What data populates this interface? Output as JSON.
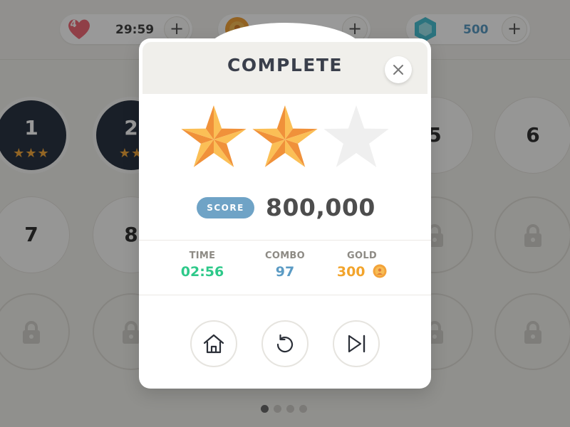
{
  "topbar": {
    "lives": {
      "count": "4",
      "timer": "29:59",
      "plus": "+"
    },
    "coins": {
      "plus": "+"
    },
    "gems": {
      "amount": "500",
      "plus": "+"
    }
  },
  "levels": {
    "l1": {
      "number": "1",
      "stars": "★★★"
    },
    "l2": {
      "number": "2",
      "stars": "★★"
    },
    "l5": {
      "number": "5"
    },
    "l6": {
      "number": "6"
    },
    "l7": {
      "number": "7"
    },
    "l8": {
      "number": "8"
    }
  },
  "pager": {
    "count": 4,
    "active_index": 0
  },
  "modal": {
    "title": "COMPLETE",
    "stars_earned": 2,
    "stars_total": 3,
    "score_label": "SCORE",
    "score_value": "800,000",
    "stats": {
      "time": {
        "label": "TIME",
        "value": "02:56"
      },
      "combo": {
        "label": "COMBO",
        "value": "97"
      },
      "gold": {
        "label": "GOLD",
        "value": "300"
      }
    },
    "buttons": {
      "close": "close-icon",
      "home": "home-icon",
      "replay": "replay-icon",
      "next": "next-level-icon"
    }
  },
  "colors": {
    "accent_blue": "#6fa3c6",
    "time_green": "#2ec98a",
    "combo_blue": "#5b9bc4",
    "gold_orange": "#f2a42c",
    "star_gold": "#f6ab3d",
    "dark_text": "#3a3f4b",
    "overlay": "rgba(0,0,0,0.40)"
  }
}
